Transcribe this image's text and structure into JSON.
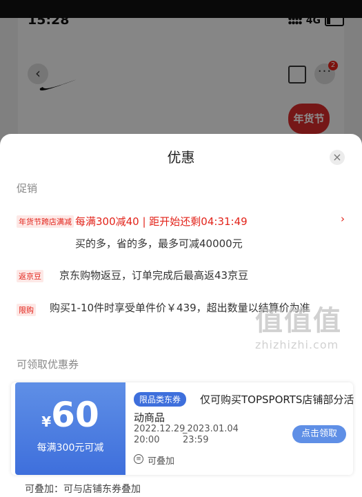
{
  "status": {
    "time": "15:28",
    "network": "4G"
  },
  "header": {
    "more_badge": "2",
    "festival_logo": "年货节"
  },
  "sheet": {
    "title": "优惠",
    "promo_section": "促销",
    "promotions": [
      {
        "tag": "年货节跨店满减",
        "main": "每满300减40 | 距开始还剩04:31:49",
        "sub": "买的多，省的多，最多可减40000元"
      },
      {
        "tag": "返京豆",
        "text": "京东购物返豆，订单完成后最高返43京豆"
      },
      {
        "tag": "限购",
        "text": "购买1-10件时享受单件价￥439，超出数量以结算价为准"
      }
    ],
    "coupon_section": "可领取优惠券",
    "coupon": {
      "currency": "¥",
      "amount": "60",
      "condition": "每满300元可减",
      "badge": "限品类东券",
      "description": "仅可购买TOPSPORTS店铺部分活动商品",
      "start_date": "2022.12.29",
      "start_time": "20:00",
      "end_date": "_2023.01.04",
      "end_time": "23:59",
      "stack_label": "可叠加",
      "button": "点击领取"
    },
    "footer": "可叠加：可与店铺东券叠加"
  },
  "watermark": {
    "big": "值值值",
    "small": "zhizhizhi.com"
  },
  "colors": {
    "accent_red": "#e2231a",
    "coupon_blue": "#3e6fdc"
  }
}
